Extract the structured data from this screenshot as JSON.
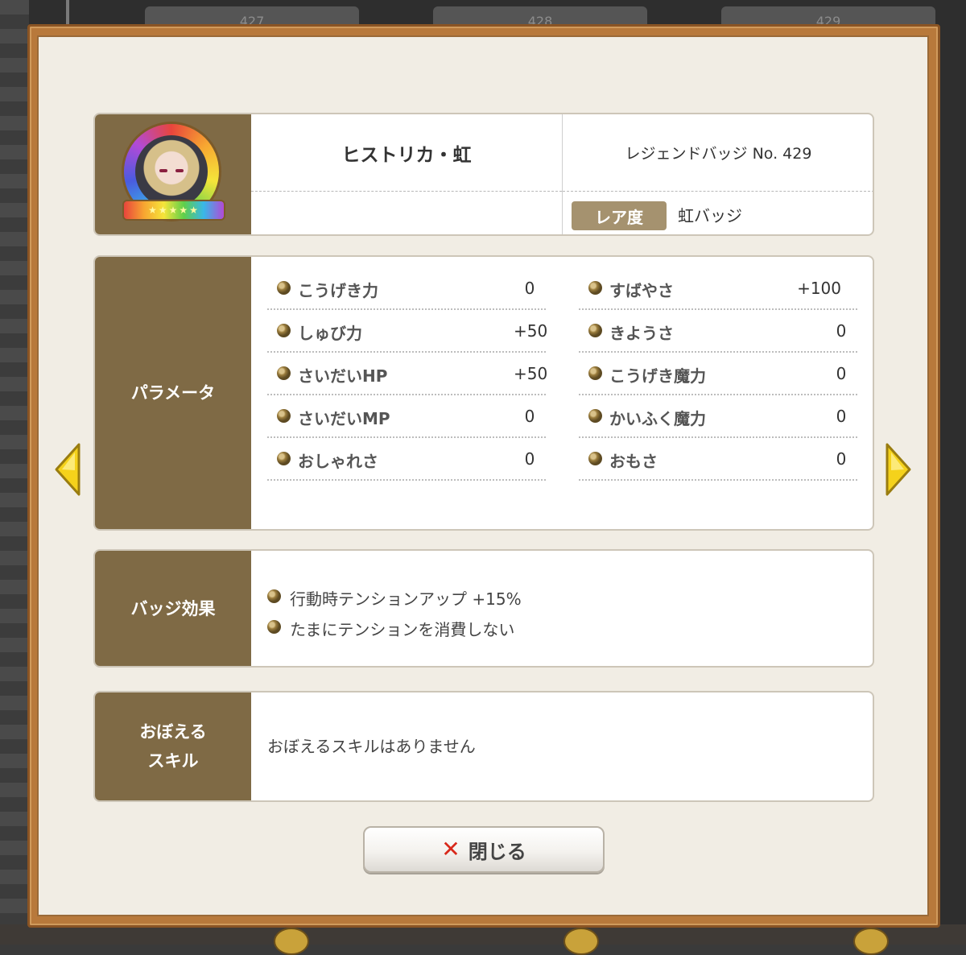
{
  "background": {
    "cards": [
      "427",
      "428",
      "429"
    ]
  },
  "header": {
    "name": "ヒストリカ・虹",
    "badge_no": "レジェンドバッジ No. 429",
    "rarity_label": "レア度",
    "rarity_value": "虹バッジ"
  },
  "params": {
    "title": "パラメータ",
    "left": [
      {
        "label": "こうげき力",
        "value": "0"
      },
      {
        "label": "しゅび力",
        "value": "+50"
      },
      {
        "label": "さいだいHP",
        "value": "+50"
      },
      {
        "label": "さいだいMP",
        "value": "0"
      },
      {
        "label": "おしゃれさ",
        "value": "0"
      }
    ],
    "right": [
      {
        "label": "すばやさ",
        "value": "+100"
      },
      {
        "label": "きようさ",
        "value": "0"
      },
      {
        "label": "こうげき魔力",
        "value": "0"
      },
      {
        "label": "かいふく魔力",
        "value": "0"
      },
      {
        "label": "おもさ",
        "value": "0"
      }
    ]
  },
  "effects": {
    "title": "バッジ効果",
    "items": [
      "行動時テンションアップ +15%",
      "たまにテンションを消費しない"
    ]
  },
  "skills": {
    "title_line1": "おぼえる",
    "title_line2": "スキル",
    "text": "おぼえるスキルはありません"
  },
  "buttons": {
    "close_label": "閉じる"
  },
  "colors": {
    "side_bg": "#7f6a45",
    "frame": "#b8793b",
    "arrow": "#f5d21b",
    "close_x": "#d8281a"
  }
}
